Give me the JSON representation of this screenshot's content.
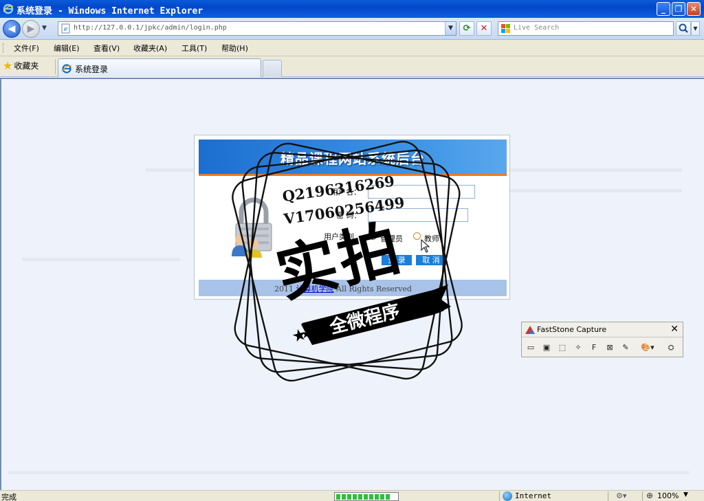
{
  "window": {
    "title": "系统登录 - Windows Internet Explorer",
    "minimize": "_",
    "maximize": "❐",
    "close": "✕"
  },
  "address": {
    "url": "http://127.0.0.1/jpkc/admin/login.php",
    "search_placeholder": "Live Search"
  },
  "menu": {
    "items": [
      "文件(F)",
      "编辑(E)",
      "查看(V)",
      "收藏夹(A)",
      "工具(T)",
      "帮助(H)"
    ]
  },
  "tabs": {
    "favorites_label": "收藏夹",
    "active_tab": "系统登录"
  },
  "login": {
    "title": "精品课程网站系统后台",
    "username_label": "用户名：",
    "password_label": "密 码：",
    "user_type_label": "用户类别",
    "role_admin": "管理员",
    "role_teacher": "教师",
    "login_button": "登 录",
    "cancel_button": "取 消",
    "footer_prefix": "2011",
    "footer_link": "计算机学院",
    "footer_suffix": "All Rights Reserved"
  },
  "watermark": {
    "qq": "Q2196316269",
    "wechat": "V17060256499",
    "headline": "实拍",
    "band": "全微程序"
  },
  "faststone": {
    "title": "FastStone Capture",
    "close": "✕"
  },
  "status": {
    "text": "完成",
    "zone": "Internet",
    "zoom": "100%",
    "progress": 0.9
  },
  "colors": {
    "titlebar": "#0347c9",
    "login_header": "#1c6ed0",
    "login_rule": "#e87b26",
    "login_footer": "#a9c3e8",
    "button": "#1b7ed8"
  }
}
